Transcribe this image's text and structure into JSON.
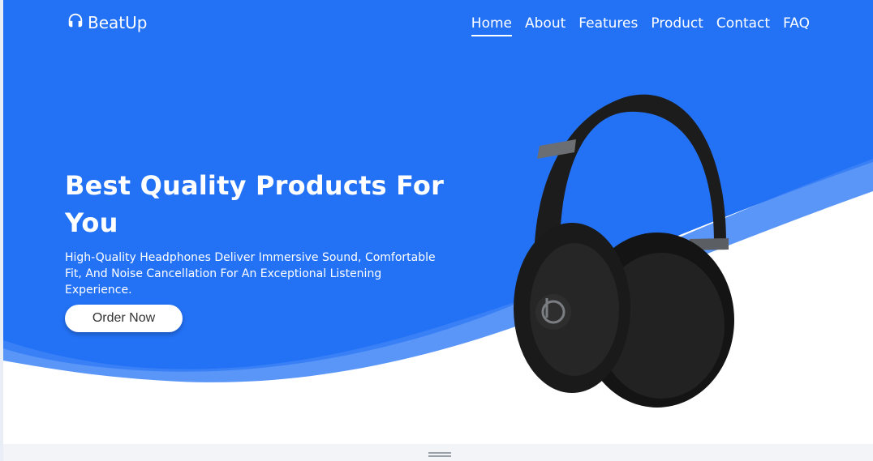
{
  "brand": {
    "name": "BeatUp",
    "icon": "headphones-icon",
    "primary_color": "#2372f6"
  },
  "nav": {
    "items": [
      {
        "label": "Home",
        "active": true
      },
      {
        "label": "About",
        "active": false
      },
      {
        "label": "Features",
        "active": false
      },
      {
        "label": "Product",
        "active": false
      },
      {
        "label": "Contact",
        "active": false
      },
      {
        "label": "FAQ",
        "active": false
      }
    ]
  },
  "hero": {
    "title": "Best Quality Products For You",
    "subtitle": "High-Quality Headphones Deliver Immersive Sound, Comfortable Fit, And Noise Cancellation For An Exceptional Listening Experience.",
    "cta_label": "Order Now",
    "product_image": "black-over-ear-headphones-image"
  }
}
